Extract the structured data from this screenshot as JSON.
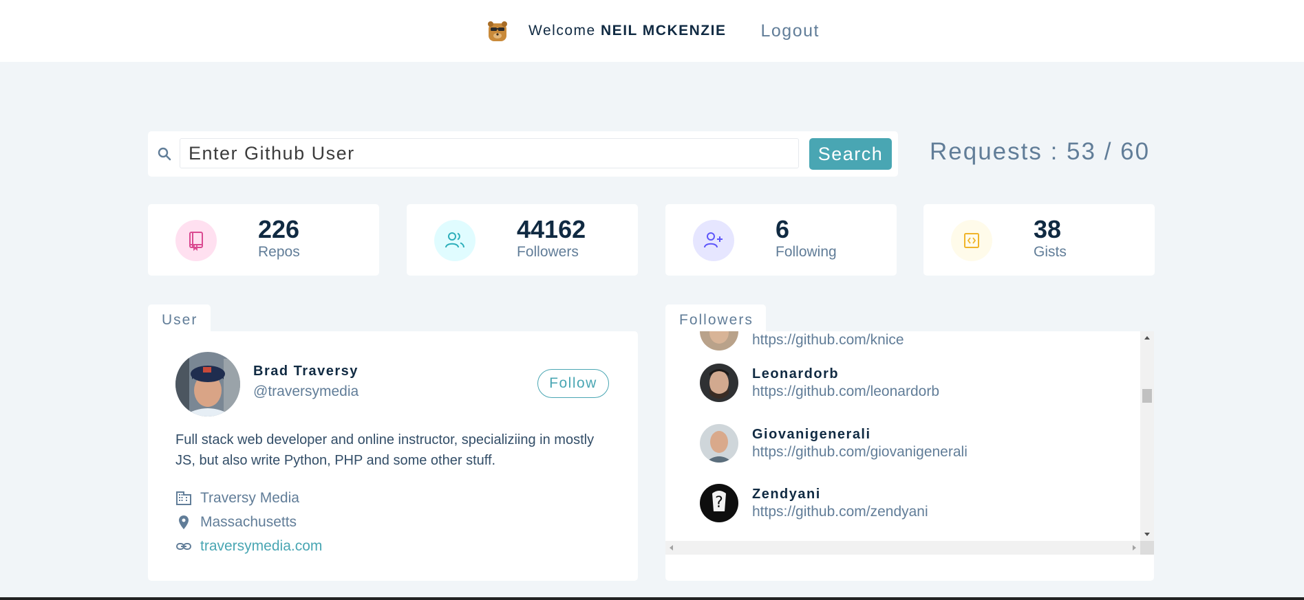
{
  "navbar": {
    "welcome_prefix": "Welcome",
    "user_name": "NEIL MCKENZIE",
    "logout_label": "Logout"
  },
  "search": {
    "placeholder": "Enter Github User",
    "button_label": "Search",
    "requests_text": "Requests : 53 / 60"
  },
  "stats": [
    {
      "value": "226",
      "label": "Repos",
      "icon": "book-icon",
      "bg": "#ffe0f0",
      "color": "#da4a91"
    },
    {
      "value": "44162",
      "label": "Followers",
      "icon": "users-icon",
      "bg": "#e0fcff",
      "color": "#2caeba"
    },
    {
      "value": "6",
      "label": "Following",
      "icon": "user-plus-icon",
      "bg": "#e6e6ff",
      "color": "#5d55fa"
    },
    {
      "value": "38",
      "label": "Gists",
      "icon": "code-icon",
      "bg": "#fffbea",
      "color": "#f0b429"
    }
  ],
  "user_panel": {
    "tab_label": "User",
    "name": "Brad Traversy",
    "handle": "@traversymedia",
    "follow_label": "Follow",
    "bio": "Full stack web developer and online instructor, specializiing in mostly JS, but also write Python, PHP and some other stuff.",
    "company": "Traversy Media",
    "location": "Massachusetts",
    "blog": "traversymedia.com"
  },
  "followers_panel": {
    "tab_label": "Followers",
    "items": [
      {
        "name": "",
        "url": "https://github.com/knice"
      },
      {
        "name": "Leonardorb",
        "url": "https://github.com/leonardorb"
      },
      {
        "name": "Giovanigenerali",
        "url": "https://github.com/giovanigenerali"
      },
      {
        "name": "Zendyani",
        "url": "https://github.com/zendyani"
      }
    ]
  },
  "colors": {
    "accent": "#49a6b3",
    "text_dark": "#102a42",
    "text_muted": "#617d98",
    "background": "#f1f5f8"
  }
}
